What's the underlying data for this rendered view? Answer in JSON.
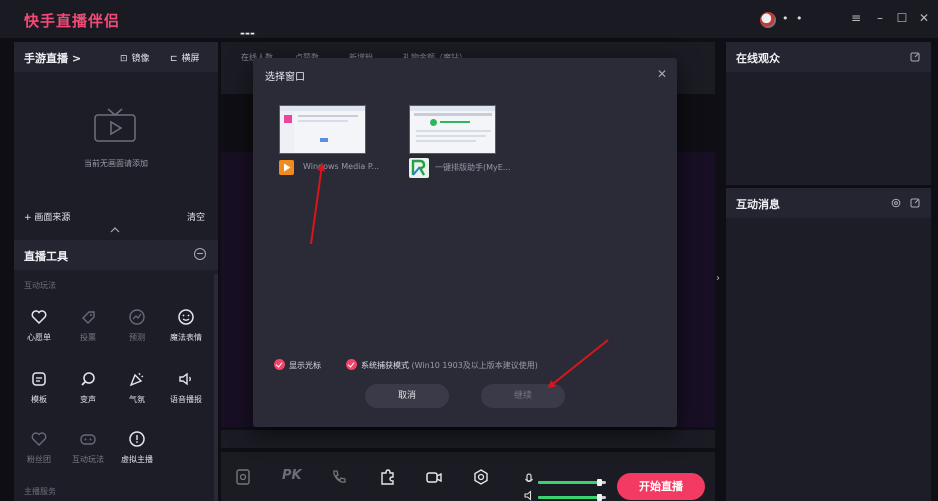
{
  "app": {
    "title": "快手直播伴侣",
    "user_name_masked": "• •",
    "window_controls": [
      "≡",
      "–",
      "☐",
      "✕"
    ]
  },
  "left_panel": {
    "mode_title": "手游直播 >",
    "mirror_label": "镜像",
    "landscape_label": "横屏",
    "empty_text": "当前无画面请添加",
    "add_source": "+ 画面来源",
    "clear": "清空"
  },
  "tools": {
    "title": "直播工具",
    "section_interactive": "互动玩法",
    "section_service": "主播服务",
    "items": [
      {
        "label": "心愿单",
        "icon": "heart-icon",
        "enabled": true
      },
      {
        "label": "投票",
        "icon": "tag-icon",
        "enabled": false
      },
      {
        "label": "预测",
        "icon": "trend-icon",
        "enabled": false
      },
      {
        "label": "魔法表情",
        "icon": "smile-icon",
        "enabled": true
      },
      {
        "label": "模板",
        "icon": "template-icon",
        "enabled": true
      },
      {
        "label": "变声",
        "icon": "mic-icon",
        "enabled": true
      },
      {
        "label": "气氛",
        "icon": "party-icon",
        "enabled": true
      },
      {
        "label": "语音播报",
        "icon": "speaker-icon",
        "enabled": true
      },
      {
        "label": "粉丝团",
        "icon": "badge-icon",
        "enabled": false
      },
      {
        "label": "互动玩法",
        "icon": "gamepad-icon",
        "enabled": false
      },
      {
        "label": "虚拟主播",
        "icon": "avatar-icon",
        "enabled": true
      }
    ]
  },
  "stats": {
    "labels": [
      "在线人数",
      "点赞数",
      "新增粉",
      "礼物金额（魔钻）"
    ],
    "value": "---"
  },
  "dialog": {
    "title": "选择窗口",
    "close": "✕",
    "windows": [
      {
        "name": "Windows Media P...",
        "icon": "media-player-icon"
      },
      {
        "name": "一键排版助手(MyE...",
        "icon": "layout-helper-icon"
      }
    ],
    "show_cursor": "显示光标",
    "system_capture": "系统捕获模式",
    "system_capture_note": "(Win10 1903及以上版本建议使用)",
    "cancel": "取消",
    "continue": "继续"
  },
  "bottom": {
    "start_label": "开始直播",
    "pk_label": "PK",
    "mic_level": 0.9,
    "speaker_level": 0.9
  },
  "right_panel": {
    "audience_title": "在线观众",
    "messages_title": "互动消息"
  },
  "colors": {
    "accent": "#f23a62",
    "title_pink": "#f34a78",
    "slider_green": "#3bd16f",
    "arrow_red": "#d8161b"
  }
}
